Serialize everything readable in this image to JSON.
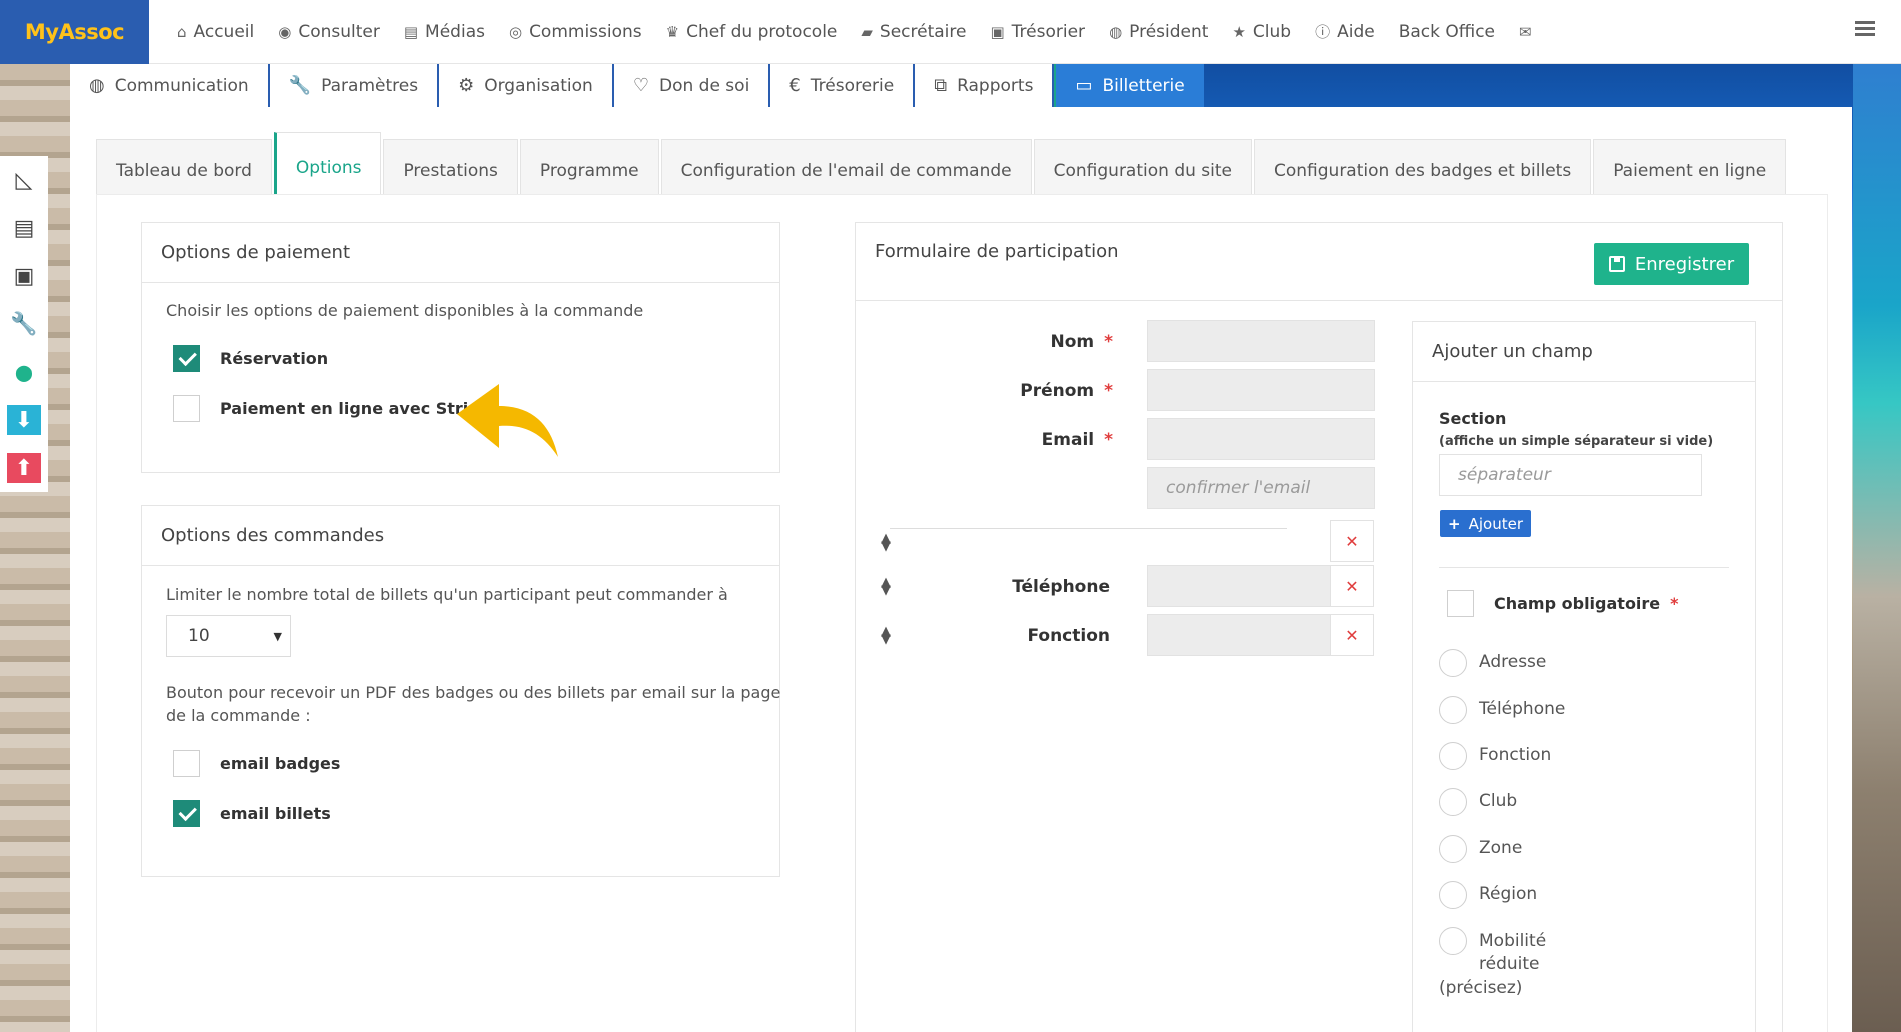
{
  "brand": "MyAssoc",
  "top_nav": [
    {
      "label": "Accueil",
      "icon": "home-icon",
      "glyph": "⌂"
    },
    {
      "label": "Consulter",
      "icon": "eye-icon",
      "glyph": "◉"
    },
    {
      "label": "Médias",
      "icon": "file-icon",
      "glyph": "▤"
    },
    {
      "label": "Commissions",
      "icon": "users-icon",
      "glyph": "◎"
    },
    {
      "label": "Chef du protocole",
      "icon": "trophy-icon",
      "glyph": "♛"
    },
    {
      "label": "Secrétaire",
      "icon": "book-icon",
      "glyph": "▰"
    },
    {
      "label": "Trésorier",
      "icon": "money-icon",
      "glyph": "▣"
    },
    {
      "label": "Président",
      "icon": "globe-icon",
      "glyph": "◍"
    },
    {
      "label": "Club",
      "icon": "star-icon",
      "glyph": "★"
    },
    {
      "label": "Aide",
      "icon": "info-icon",
      "glyph": "ⓘ"
    },
    {
      "label": "Back Office",
      "icon": "",
      "glyph": ""
    },
    {
      "label": "",
      "icon": "envelope-icon",
      "glyph": "✉"
    }
  ],
  "main_nav": [
    {
      "label": "Communication",
      "icon": "globe-icon",
      "glyph": "◍"
    },
    {
      "label": "Paramètres",
      "icon": "wrench-icon",
      "glyph": "🔧"
    },
    {
      "label": "Organisation",
      "icon": "cogs-icon",
      "glyph": "⚙"
    },
    {
      "label": "Don de soi",
      "icon": "heart-icon",
      "glyph": "♡"
    },
    {
      "label": "Trésorerie",
      "icon": "euro-icon",
      "glyph": "€"
    },
    {
      "label": "Rapports",
      "icon": "copy-icon",
      "glyph": "⧉"
    },
    {
      "label": "Billetterie",
      "icon": "credit-card-icon",
      "glyph": "▭",
      "active": true
    }
  ],
  "side_strip": [
    {
      "icon": "area-chart-icon",
      "glyph": "◺",
      "bg": ""
    },
    {
      "icon": "document-icon",
      "glyph": "▤",
      "bg": ""
    },
    {
      "icon": "money-icon",
      "glyph": "▣",
      "bg": ""
    },
    {
      "icon": "wrench-icon",
      "glyph": "🔧",
      "bg": ""
    },
    {
      "icon": "map-marker-icon",
      "glyph": "⬤",
      "bg": ""
    },
    {
      "icon": "arrow-down-icon",
      "glyph": "⬇",
      "bg": "#2ab3d6"
    },
    {
      "icon": "arrow-up-icon",
      "glyph": "⬆",
      "bg": "#e84a5f"
    }
  ],
  "sub_tabs": [
    {
      "label": "Tableau de bord"
    },
    {
      "label": "Options",
      "active": true
    },
    {
      "label": "Prestations"
    },
    {
      "label": "Programme"
    },
    {
      "label": "Configuration de l'email de commande"
    },
    {
      "label": "Configuration du site"
    },
    {
      "label": "Configuration des badges et billets"
    },
    {
      "label": "Paiement en ligne"
    }
  ],
  "payment_options": {
    "title": "Options de paiement",
    "help": "Choisir les options de paiement disponibles à la commande",
    "reservation": {
      "label": "Réservation",
      "checked": true
    },
    "stripe": {
      "label": "Paiement en ligne avec Stripe",
      "checked": false
    }
  },
  "order_options": {
    "title": "Options des commandes",
    "limit_label": "Limiter le nombre total de billets qu'un participant peut commander à",
    "limit_value": "10",
    "pdf_label_1": "Bouton pour recevoir un PDF des badges ou des billets par email sur la page",
    "pdf_label_2": "de la commande :",
    "email_badges": {
      "label": "email badges",
      "checked": false
    },
    "email_billets": {
      "label": "email billets",
      "checked": true
    }
  },
  "form": {
    "title": "Formulaire de participation",
    "save_label": "Enregistrer",
    "fields": {
      "nom": "Nom",
      "prenom": "Prénom",
      "email": "Email",
      "email_confirm_placeholder": "confirmer l'email",
      "telephone": "Téléphone",
      "fonction": "Fonction"
    },
    "required_mark": "*"
  },
  "add_field": {
    "title": "Ajouter un champ",
    "section_label": "Section",
    "section_hint": "(affiche un simple séparateur si vide)",
    "section_placeholder": "séparateur",
    "add_label": "Ajouter",
    "mandatory_label": "Champ obligatoire",
    "options": [
      "Adresse",
      "Téléphone",
      "Fonction",
      "Club",
      "Zone",
      "Région",
      "Mobilité",
      "réduite",
      "(précisez)"
    ]
  },
  "colors": {
    "brand_bg": "#2a5db0",
    "brand_text": "#ffc21a",
    "accent": "#1aa58a",
    "save_button": "#1fb38c",
    "add_button": "#2a6fcf",
    "required": "#e03d3d",
    "arrow": "#f5b800"
  }
}
